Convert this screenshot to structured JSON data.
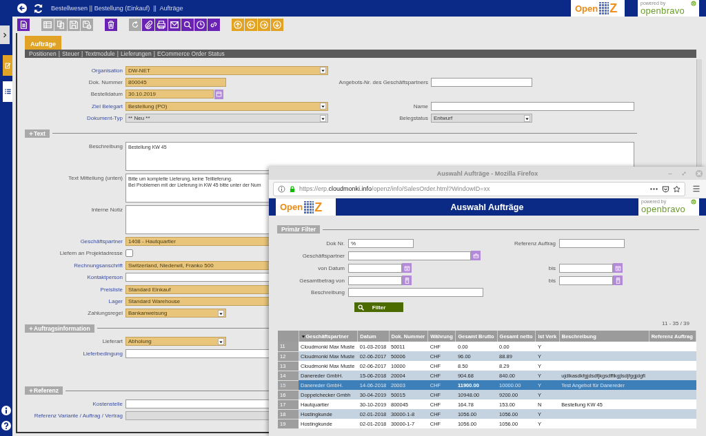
{
  "topbar": {
    "breadcrumb": "Bestellwesen || Bestellung (Einkauf)  ||  Aufträge",
    "logo_open": {
      "text": "Open",
      "mark": "Z"
    },
    "logo_powered": {
      "caption": "powered by",
      "brand": "openbravo"
    }
  },
  "sidebar": {
    "views": [
      {
        "kind": "form",
        "selected": true
      },
      {
        "kind": "grid",
        "selected": false
      }
    ]
  },
  "toolbar": [
    {
      "kind": "new",
      "disabled": false
    },
    {
      "kind": "grid",
      "disabled": true
    },
    {
      "kind": "copy",
      "disabled": true
    },
    {
      "kind": "save",
      "disabled": true
    },
    {
      "kind": "save-close",
      "disabled": true
    },
    {
      "kind": "delete",
      "disabled": false
    },
    {
      "kind": "undo",
      "disabled": true
    },
    {
      "kind": "attach",
      "disabled": false
    },
    {
      "kind": "print",
      "disabled": false
    },
    {
      "kind": "mail",
      "disabled": false
    },
    {
      "kind": "search",
      "disabled": false
    },
    {
      "kind": "history",
      "disabled": false
    },
    {
      "kind": "link",
      "disabled": false
    },
    {
      "kind": "nav-up",
      "disabled": false
    },
    {
      "kind": "nav-left",
      "disabled": false
    },
    {
      "kind": "nav-right",
      "disabled": false
    },
    {
      "kind": "nav-down",
      "disabled": false
    }
  ],
  "tabs": [
    {
      "label": "Aufträge",
      "selected": true
    }
  ],
  "subtabs": {
    "separator": "|",
    "items": [
      "Positionen",
      "Steuer",
      "Textmodule",
      "Lieferungen",
      "ECommerce Order Status"
    ]
  },
  "form": {
    "sections": [
      {
        "rows": [
          {
            "cells": [
              {
                "label": "Organisation",
                "link": true,
                "kind": "select",
                "value": "DW-NET",
                "mandatory": true,
                "readonly": false
              }
            ]
          },
          {
            "cells": [
              {
                "label": "Dok. Nummer",
                "link": false,
                "kind": "text",
                "value": "800045",
                "mandatory": true,
                "readonly": false
              },
              {
                "label": "Angebots-Nr. des Geschäftspartners",
                "link": false,
                "kind": "text",
                "mandatory": false,
                "readonly": false
              }
            ]
          },
          {
            "cells": [
              {
                "label": "Bestelldatum",
                "link": false,
                "kind": "date",
                "value": "30.10.2019",
                "mandatory": true,
                "readonly": false
              }
            ]
          },
          {
            "cells": [
              {
                "label": "Ziel Belegart",
                "link": true,
                "kind": "select",
                "value": "Bestellung (PO)",
                "mandatory": true,
                "readonly": false
              },
              {
                "label": "Name",
                "link": false,
                "kind": "text",
                "mandatory": false,
                "readonly": false
              }
            ]
          },
          {
            "cells": [
              {
                "label": "Dokument-Typ",
                "link": true,
                "kind": "select",
                "value": "** Neu **",
                "mandatory": false,
                "readonly": true
              },
              {
                "label": "Belegstatus",
                "link": false,
                "kind": "select",
                "value": "Entwurf",
                "mandatory": false,
                "readonly": true
              }
            ]
          }
        ]
      },
      {
        "title": "Text",
        "rows": [
          {
            "cells": [
              {
                "label": "Beschreibung",
                "link": false,
                "kind": "textarea",
                "value": "Bestellung KW 45",
                "mandatory": false,
                "readonly": false
              }
            ]
          },
          {
            "cells": [
              {
                "label": "Text Mitteilung (unten)",
                "link": false,
                "kind": "textarea",
                "value": "Bitte um komplette Lieferung, keine Teillieferung.\nBei Problemen mit der Lieferung in KW 45 bitte unter der Num",
                "mandatory": false,
                "readonly": false
              }
            ]
          },
          {
            "cells": [
              {
                "label": "Interne Notiz",
                "link": false,
                "kind": "textarea",
                "mandatory": false,
                "readonly": false
              }
            ]
          },
          {
            "cells": [
              {
                "label": "Geschäftspartner",
                "link": true,
                "kind": "text",
                "value": "1408 - Hautquartier",
                "mandatory": true,
                "readonly": false
              }
            ]
          },
          {
            "cells": [
              {
                "label": "Liefern an Projektadresse",
                "link": false,
                "kind": "checkbox",
                "checked": false
              }
            ]
          },
          {
            "cells": [
              {
                "label": "Rechnungsanschrift",
                "link": true,
                "kind": "text",
                "value": "Switzerland, Niederwil, Franko 500",
                "mandatory": true,
                "readonly": false
              }
            ]
          },
          {
            "cells": [
              {
                "label": "Kontaktperson",
                "link": true,
                "kind": "text",
                "mandatory": false,
                "readonly": false
              }
            ]
          },
          {
            "cells": [
              {
                "label": "Preisliste",
                "link": true,
                "kind": "text",
                "value": "Standard Einkauf",
                "mandatory": true,
                "readonly": false
              }
            ]
          },
          {
            "cells": [
              {
                "label": "Lager",
                "link": true,
                "kind": "text",
                "value": "Standard Warehouse",
                "mandatory": true,
                "readonly": false
              }
            ]
          },
          {
            "cells": [
              {
                "label": "Zahlungsregel",
                "link": false,
                "kind": "select",
                "value": "Bankanweisung",
                "mandatory": true,
                "readonly": false
              }
            ]
          }
        ]
      },
      {
        "title": "Auftragsinformation",
        "rows": [
          {
            "cells": [
              {
                "label": "Lieferart",
                "link": false,
                "kind": "select",
                "value": "Abholung",
                "mandatory": true,
                "readonly": false
              }
            ]
          },
          {
            "cells": [
              {
                "label": "Lieferbedingung",
                "link": true,
                "kind": "text",
                "mandatory": false,
                "readonly": false
              }
            ]
          }
        ]
      },
      {
        "title": "Referenz",
        "rows": [
          {
            "cells": [
              {
                "label": "Kostenstelle",
                "link": true,
                "kind": "text",
                "mandatory": false,
                "readonly": false
              }
            ]
          },
          {
            "cells": [
              {
                "label": "Referenz Variante / Auftrag / Vertrag",
                "link": true,
                "kind": "text",
                "mandatory": false,
                "readonly": true
              }
            ]
          }
        ]
      }
    ]
  },
  "popup": {
    "window_title": "Auswahl Aufträge - Mozilla Firefox",
    "url": "https://erp.**cloudmonki.info**/openz/info/SalesOrder.html?WindowID=xx",
    "header": {
      "logo_open": {
        "text": "Open",
        "mark": "Z"
      },
      "title": "Auswahl Aufträge",
      "logo_powered": {
        "caption": "powered by",
        "brand": "openbravo"
      }
    },
    "filter_title": "Primär Filter",
    "filters": [
      {
        "cells": [
          {
            "label": "Dok Nr.",
            "kind": "text",
            "value": "%"
          },
          {
            "label": "Referenz Auftrag",
            "kind": "text"
          }
        ]
      },
      {
        "cells": [
          {
            "label": "Geschäftspartner",
            "kind": "lookup"
          }
        ]
      },
      {
        "cells": [
          {
            "label": "von Datum",
            "kind": "date"
          },
          {
            "label": "bis",
            "kind": "date"
          }
        ]
      },
      {
        "cells": [
          {
            "label": "Gesamtbetrag von",
            "kind": "amount"
          },
          {
            "label": "bis",
            "kind": "amount"
          }
        ]
      },
      {
        "cells": [
          {
            "label": "Beschreibung",
            "kind": "text"
          }
        ]
      }
    ],
    "filter_button": "Filter",
    "count": "11 - 35 / 39",
    "table": {
      "columns": [
        {
          "label": "Geschäftspartner",
          "sorted": true
        },
        {
          "label": "Datum",
          "sorted": false
        },
        {
          "label": "Dok. Nummer",
          "sorted": false
        },
        {
          "label": "Währung",
          "sorted": false
        },
        {
          "label": "Gesamt Brutto",
          "sorted": false
        },
        {
          "label": "Gesamt netto",
          "sorted": false
        },
        {
          "label": "Ist Verk",
          "sorted": false
        },
        {
          "label": "Beschreibung",
          "sorted": false
        },
        {
          "label": "Referenz Auftrag",
          "sorted": false
        }
      ],
      "rows": [
        {
          "number": "11",
          "selected": false,
          "cells": [
            "Cloudmonki Max Muste",
            "01-03-2018",
            "50011",
            "CHF",
            "0.00",
            "0.00",
            "Y"
          ]
        },
        {
          "number": "12",
          "selected": false,
          "cells": [
            "Cloudmonki Max Muste",
            "02-06-2017",
            "50006",
            "CHF",
            "96.00",
            "88.89",
            "Y"
          ]
        },
        {
          "number": "13",
          "selected": false,
          "cells": [
            "Cloudmonki Max Muste",
            "02-06-2017",
            "10000",
            "CHF",
            "8.50",
            "8.29",
            "Y"
          ]
        },
        {
          "number": "14",
          "selected": false,
          "cells": [
            "Danereder GmbH.",
            "15-06-2018",
            "20004",
            "CHF",
            "904.68",
            "840.00",
            "Y",
            "ujdlkasdkfgjdsdfjkgsdfflkgjlsdjfggjdgfl"
          ]
        },
        {
          "number": "15",
          "selected": true,
          "cells": [
            "Danereder GmbH.",
            "14-06-2018",
            "20003",
            "CHF",
            "11900.00",
            "10000.00",
            "Y",
            "Test Angebot für Danereder"
          ]
        },
        {
          "number": "16",
          "selected": false,
          "cells": [
            "Doppelchecker Gmbh",
            "30-04-2019",
            "50015",
            "CHF",
            "10948.00",
            "9200.00",
            "Y"
          ]
        },
        {
          "number": "17",
          "selected": false,
          "cells": [
            "Hautquartier",
            "30-10-2019",
            "800045",
            "CHF",
            "164.78",
            "153.00",
            "N",
            "Bestellung KW 45"
          ]
        },
        {
          "number": "18",
          "selected": false,
          "cells": [
            "Hostingkunde",
            "02-01-2018",
            "30000-1-8",
            "CHF",
            "1056.00",
            "1056.00",
            "Y"
          ]
        },
        {
          "number": "19",
          "selected": false,
          "cells": [
            "Hostingkunde",
            "02-01-2018",
            "30000-1-7",
            "CHF",
            "1056.00",
            "1056.00",
            "Y"
          ]
        }
      ]
    }
  }
}
